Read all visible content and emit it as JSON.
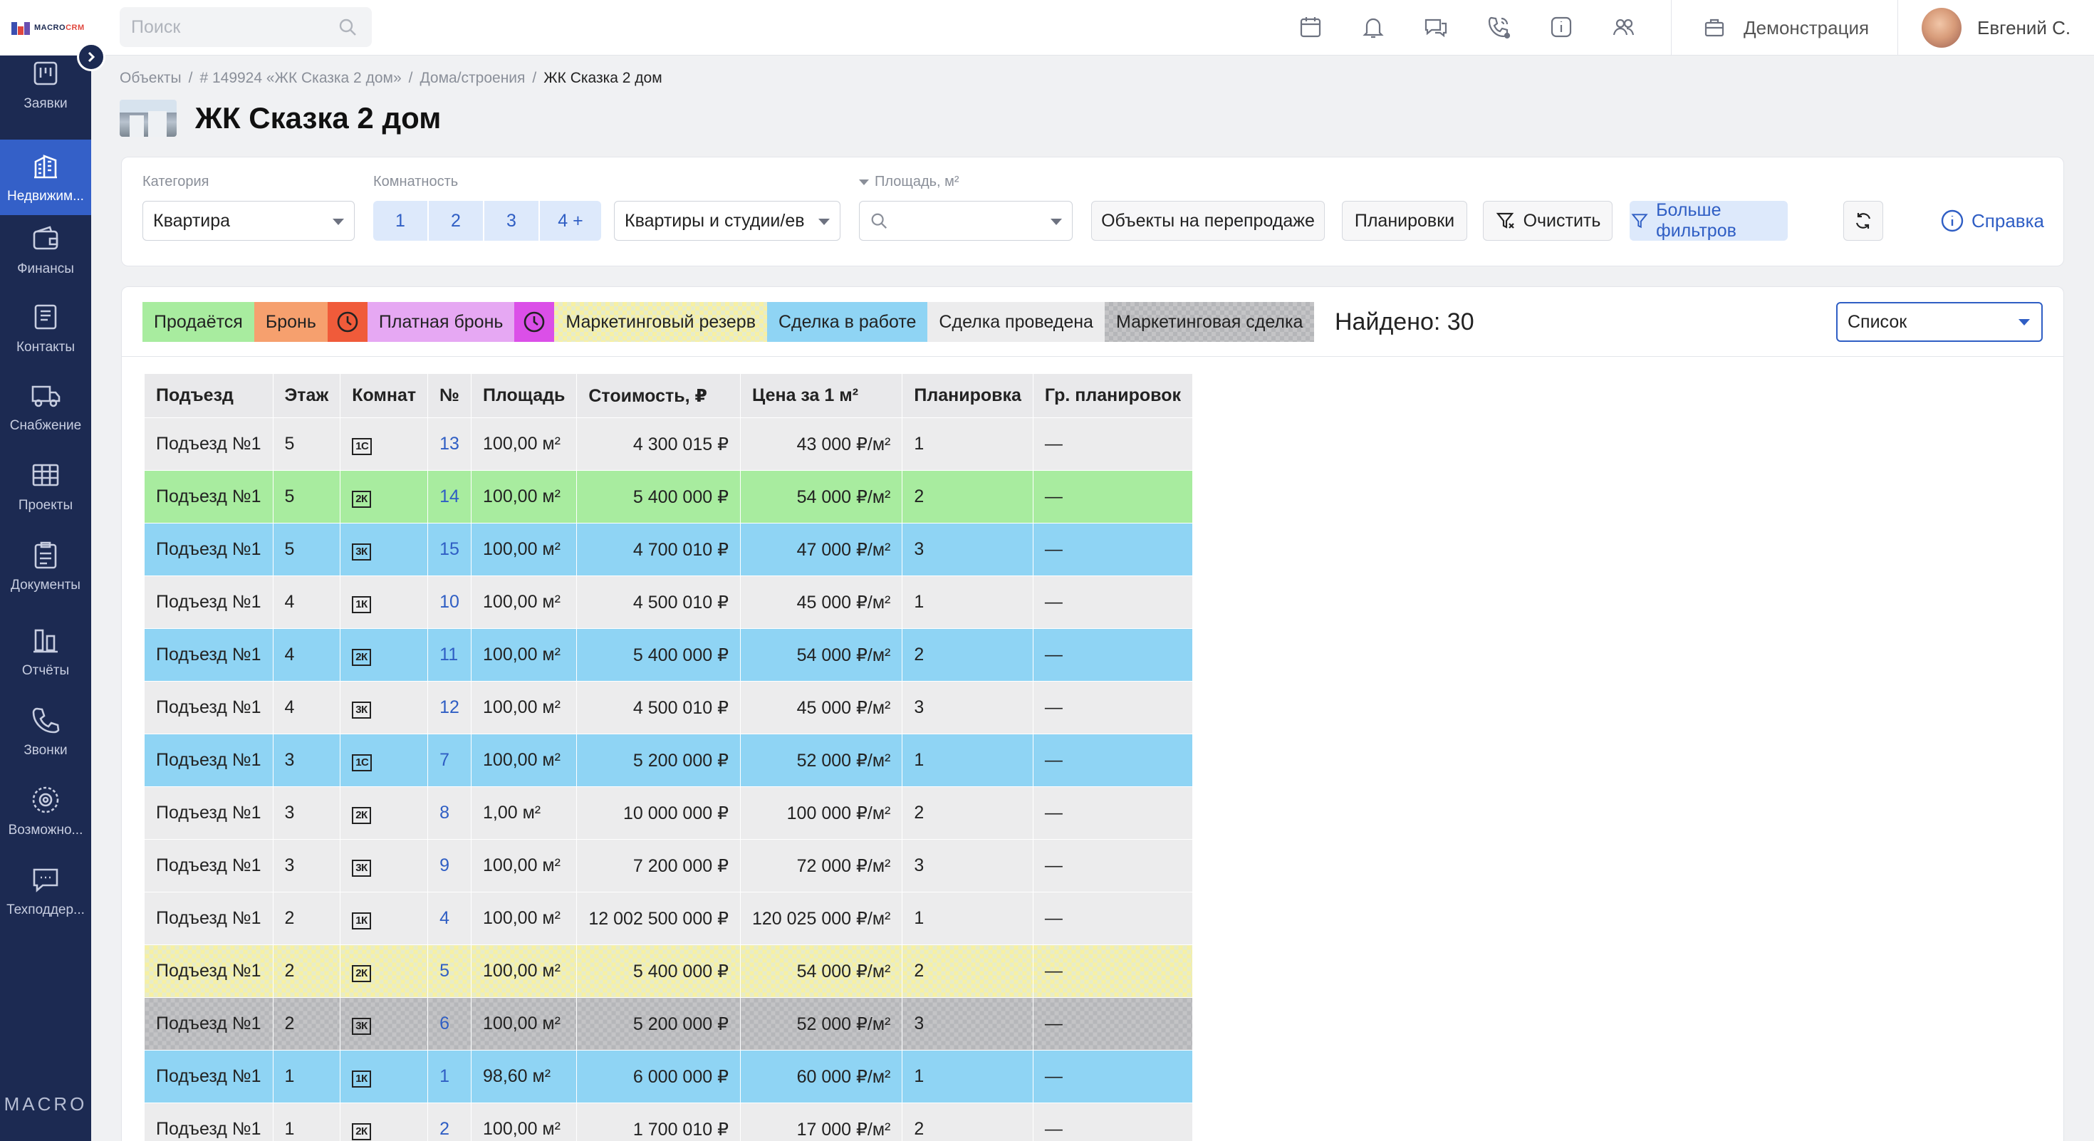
{
  "app": {
    "logo_main": "MACRO",
    "logo_accent": "CRM",
    "footer_brand": "MACRO"
  },
  "sidebar": {
    "items": [
      {
        "label": "Заявки",
        "icon": "requests-icon"
      },
      {
        "label": "Недвижим...",
        "icon": "building-icon",
        "active": true
      },
      {
        "label": "Финансы",
        "icon": "wallet-icon"
      },
      {
        "label": "Контакты",
        "icon": "contacts-icon"
      },
      {
        "label": "Снабжение",
        "icon": "truck-icon"
      },
      {
        "label": "Проекты",
        "icon": "projects-icon"
      },
      {
        "label": "Документы",
        "icon": "clipboard-icon"
      },
      {
        "label": "Отчёты",
        "icon": "reports-icon"
      },
      {
        "label": "Звонки",
        "icon": "phone-icon"
      },
      {
        "label": "Возможно...",
        "icon": "gear-icon"
      },
      {
        "label": "Техподдер...",
        "icon": "chat-icon"
      }
    ]
  },
  "header": {
    "search_placeholder": "Поиск",
    "icons": [
      "calendar-icon",
      "bell-icon",
      "messages-icon",
      "phone-icon",
      "info-icon",
      "users-icon"
    ],
    "demo_label": "Демонстрация",
    "user_name": "Евгений С."
  },
  "breadcrumbs": [
    "Объекты",
    "# 149924 «ЖК Сказка 2 дом»",
    "Дома/строения",
    "ЖК Сказка 2 дом"
  ],
  "page_title": "ЖК Сказка 2 дом",
  "filters": {
    "category_label": "Категория",
    "category_value": "Квартира",
    "rooms_label": "Комнатность",
    "rooms": [
      "1",
      "2",
      "3",
      "4 +"
    ],
    "type_value": "Квартиры и студии/ев",
    "area_label": "Площадь, м²",
    "resale_button": "Объекты на перепродаже",
    "layouts_button": "Планировки",
    "clear_button": "Очистить",
    "more_filters_button": "Больше фильтров",
    "help_link": "Справка"
  },
  "legend": [
    {
      "label": "Продаётся",
      "color": "#a8ec9f"
    },
    {
      "label": "Бронь",
      "color": "#f6a06e"
    },
    {
      "label": "Платная бронь",
      "color": "#e6a8f3"
    },
    {
      "label": "Маркетинговый резерв",
      "color": "#f7f0a3"
    },
    {
      "label": "Сделка в работе",
      "color": "#8fd4f4"
    },
    {
      "label": "Сделка проведена",
      "color": "#ececed"
    },
    {
      "label": "Маркетинговая сделка",
      "color": "#c4c4c6"
    }
  ],
  "found_text": "Найдено: 30",
  "view_select": "Список",
  "table": {
    "headers": [
      "Подъезд",
      "Этаж",
      "Комнат",
      "№",
      "Площадь",
      "Стоимость, ₽",
      "Цена за 1 м²",
      "Планировка",
      "Гр. планировок"
    ],
    "rows": [
      {
        "entrance": "Подъезд №1",
        "floor": "5",
        "rooms": "1С",
        "num": "13",
        "area": "100,00 м²",
        "price": "4 300 015 ₽",
        "ppm": "43 000 ₽/м²",
        "layout": "1",
        "group": "—",
        "status": "default"
      },
      {
        "entrance": "Подъезд №1",
        "floor": "5",
        "rooms": "2К",
        "num": "14",
        "area": "100,00 м²",
        "price": "5 400 000 ₽",
        "ppm": "54 000 ₽/м²",
        "layout": "2",
        "group": "—",
        "status": "green"
      },
      {
        "entrance": "Подъезд №1",
        "floor": "5",
        "rooms": "3К",
        "num": "15",
        "area": "100,00 м²",
        "price": "4 700 010 ₽",
        "ppm": "47 000 ₽/м²",
        "layout": "3",
        "group": "—",
        "status": "blue"
      },
      {
        "entrance": "Подъезд №1",
        "floor": "4",
        "rooms": "1К",
        "num": "10",
        "area": "100,00 м²",
        "price": "4 500 010 ₽",
        "ppm": "45 000 ₽/м²",
        "layout": "1",
        "group": "—",
        "status": "default"
      },
      {
        "entrance": "Подъезд №1",
        "floor": "4",
        "rooms": "2К",
        "num": "11",
        "area": "100,00 м²",
        "price": "5 400 000 ₽",
        "ppm": "54 000 ₽/м²",
        "layout": "2",
        "group": "—",
        "status": "blue"
      },
      {
        "entrance": "Подъезд №1",
        "floor": "4",
        "rooms": "3К",
        "num": "12",
        "area": "100,00 м²",
        "price": "4 500 010 ₽",
        "ppm": "45 000 ₽/м²",
        "layout": "3",
        "group": "—",
        "status": "default"
      },
      {
        "entrance": "Подъезд №1",
        "floor": "3",
        "rooms": "1С",
        "num": "7",
        "area": "100,00 м²",
        "price": "5 200 000 ₽",
        "ppm": "52 000 ₽/м²",
        "layout": "1",
        "group": "—",
        "status": "blue"
      },
      {
        "entrance": "Подъезд №1",
        "floor": "3",
        "rooms": "2К",
        "num": "8",
        "area": "1,00 м²",
        "price": "10 000 000 ₽",
        "ppm": "100 000 ₽/м²",
        "layout": "2",
        "group": "—",
        "status": "default"
      },
      {
        "entrance": "Подъезд №1",
        "floor": "3",
        "rooms": "3К",
        "num": "9",
        "area": "100,00 м²",
        "price": "7 200 000 ₽",
        "ppm": "72 000 ₽/м²",
        "layout": "3",
        "group": "—",
        "status": "default"
      },
      {
        "entrance": "Подъезд №1",
        "floor": "2",
        "rooms": "1К",
        "num": "4",
        "area": "100,00 м²",
        "price": "12 002 500 000 ₽",
        "ppm": "120 025 000 ₽/м²",
        "layout": "1",
        "group": "—",
        "status": "default"
      },
      {
        "entrance": "Подъезд №1",
        "floor": "2",
        "rooms": "2К",
        "num": "5",
        "area": "100,00 м²",
        "price": "5 400 000 ₽",
        "ppm": "54 000 ₽/м²",
        "layout": "2",
        "group": "—",
        "status": "yellow"
      },
      {
        "entrance": "Подъезд №1",
        "floor": "2",
        "rooms": "3К",
        "num": "6",
        "area": "100,00 м²",
        "price": "5 200 000 ₽",
        "ppm": "52 000 ₽/м²",
        "layout": "3",
        "group": "—",
        "status": "grey"
      },
      {
        "entrance": "Подъезд №1",
        "floor": "1",
        "rooms": "1К",
        "num": "1",
        "area": "98,60 м²",
        "price": "6 000 000 ₽",
        "ppm": "60 000 ₽/м²",
        "layout": "1",
        "group": "—",
        "status": "blue"
      },
      {
        "entrance": "Подъезд №1",
        "floor": "1",
        "rooms": "2К",
        "num": "2",
        "area": "100,00 м²",
        "price": "1 700 010 ₽",
        "ppm": "17 000 ₽/м²",
        "layout": "2",
        "group": "—",
        "status": "default"
      }
    ]
  }
}
